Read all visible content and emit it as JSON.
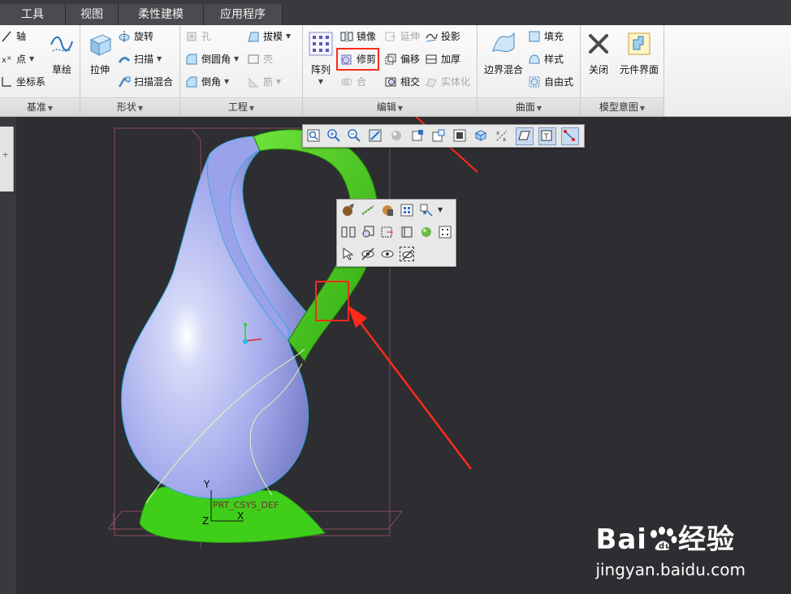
{
  "tabs": [
    {
      "label": "工具"
    },
    {
      "label": "视图"
    },
    {
      "label": "柔性建模"
    },
    {
      "label": "应用程序"
    }
  ],
  "groups": {
    "datum": {
      "label": "基准",
      "axis": "轴",
      "point": "点",
      "csys": "坐标系",
      "sketch": "草绘"
    },
    "shapes": {
      "label": "形状",
      "extrude": "拉伸",
      "revolve": "旋转",
      "sweep": "扫描",
      "swept_blend": "扫描混合"
    },
    "engineering": {
      "label": "工程",
      "hole": "孔",
      "round": "倒圆角",
      "chamfer": "倒角",
      "draft": "拔模",
      "shell": "壳",
      "rib": "筋"
    },
    "editing": {
      "label": "编辑",
      "pattern": "阵列",
      "mirror": "镜像",
      "trim": "修剪",
      "merge": "合",
      "extend": "延伸",
      "offset": "偏移",
      "intersect": "相交",
      "project": "投影",
      "thicken": "加厚",
      "solidify": "实体化"
    },
    "surfaces": {
      "label": "曲面",
      "boundary_blend": "边界混合",
      "fill": "填充",
      "style": "样式",
      "freestyle": "自由式"
    },
    "model_intent": {
      "label": "模型意图",
      "close": "关闭",
      "component_interface": "元件界面"
    }
  },
  "viewport": {
    "axis_y": "Y",
    "axis_z": "Z",
    "axis_x": "X",
    "csys_label": "PRT_CSYS_DEF"
  },
  "watermark": {
    "brand_text": "Bai",
    "brand_text2": "经验",
    "url": "jingyan.baidu.com"
  },
  "colors": {
    "tab_bg": "#4a4a4f",
    "ribbon_bg": "#f2f2f2",
    "viewport_bg": "#2d2d32",
    "model_body": "#a7aeef",
    "model_highlight": "#3fcf1a",
    "callout": "#ff2a1a"
  }
}
